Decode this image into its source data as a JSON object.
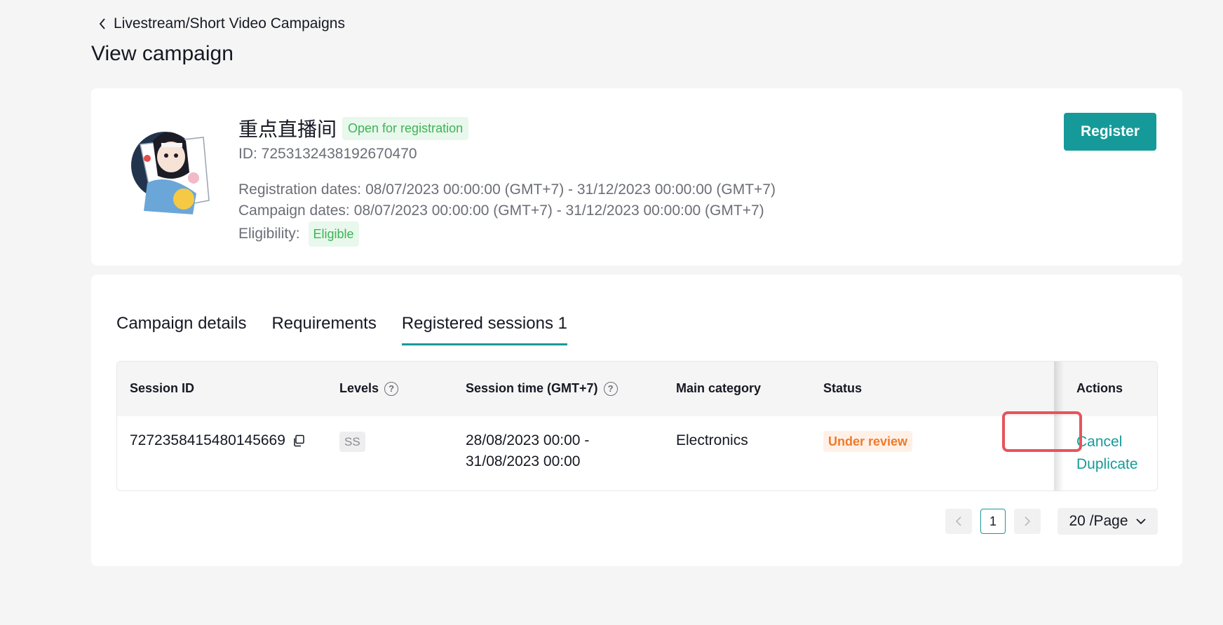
{
  "breadcrumb": {
    "label": "Livestream/Short Video Campaigns"
  },
  "page": {
    "title": "View campaign"
  },
  "campaign": {
    "name": "重点直播间",
    "status_tag": "Open for registration",
    "id_text": "ID: 7253132438192670470",
    "registration_label": "Registration dates:",
    "registration_value": "08/07/2023 00:00:00 (GMT+7) - 31/12/2023 00:00:00 (GMT+7)",
    "campaign_label": "Campaign dates:",
    "campaign_value": "08/07/2023 00:00:00 (GMT+7) - 31/12/2023 00:00:00 (GMT+7)",
    "eligibility_label": "Eligibility:",
    "eligibility_value": "Eligible",
    "register_label": "Register"
  },
  "tabs": [
    {
      "label": "Campaign details"
    },
    {
      "label": "Requirements"
    },
    {
      "label": "Registered sessions 1"
    }
  ],
  "table": {
    "headers": {
      "session_id": "Session ID",
      "levels": "Levels",
      "session_time": "Session time (GMT+7)",
      "main_category": "Main category",
      "status": "Status",
      "actions": "Actions"
    },
    "rows": [
      {
        "session_id": "7272358415480145669",
        "level": "SS",
        "time_line1": "28/08/2023 00:00 -",
        "time_line2": "31/08/2023 00:00",
        "category": "Electronics",
        "status": "Under review",
        "action_cancel": "Cancel",
        "action_duplicate": "Duplicate"
      }
    ]
  },
  "pagination": {
    "current": "1",
    "per_page": "20 /Page"
  },
  "colors": {
    "accent": "#169a99",
    "highlight": "#e8545a",
    "eligible": "#3eb356",
    "review": "#f07a2a"
  }
}
